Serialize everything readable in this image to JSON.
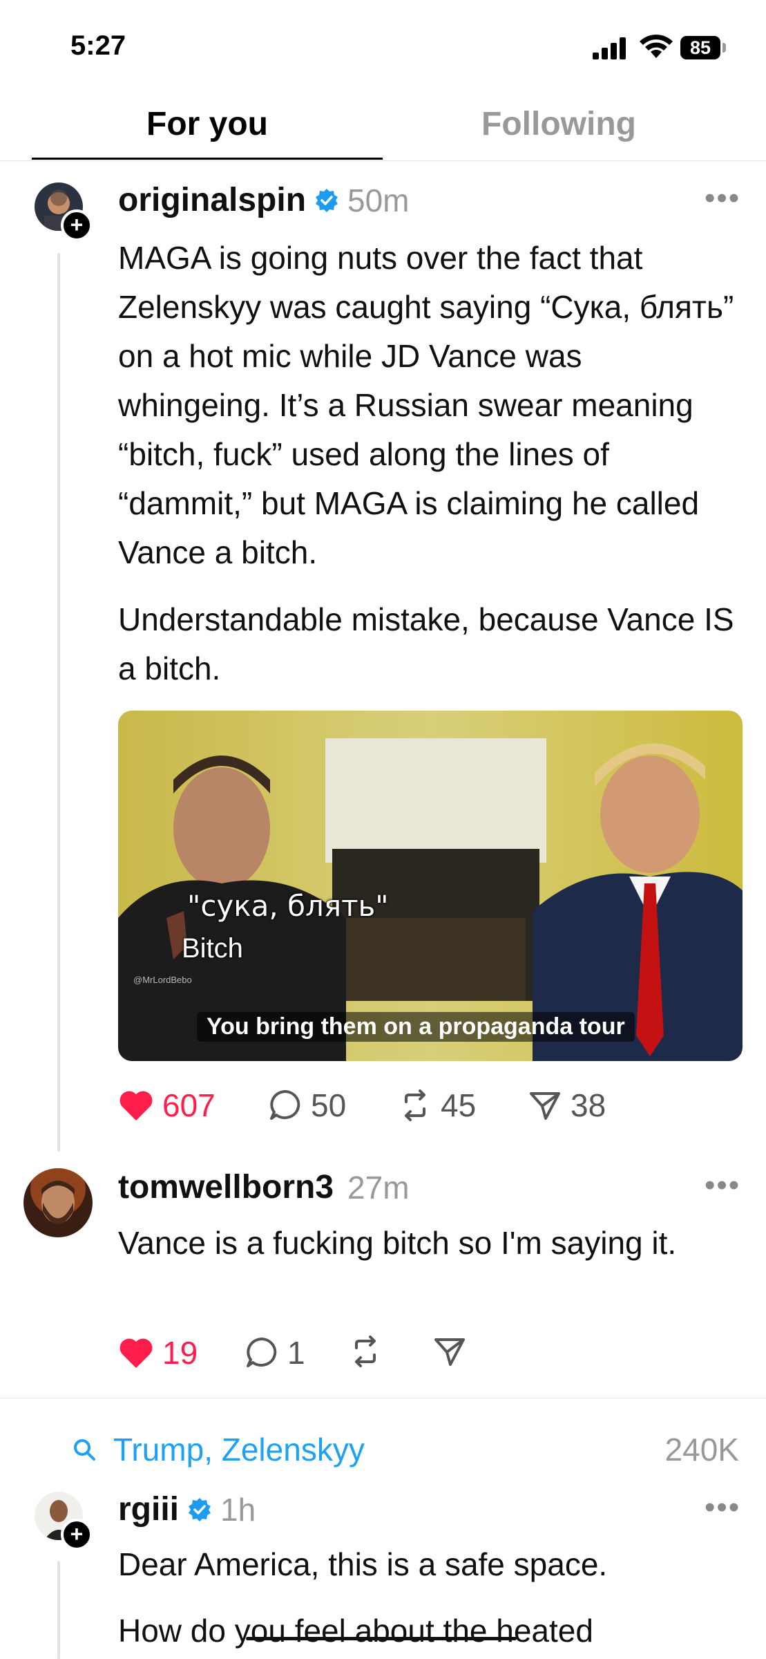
{
  "status_bar": {
    "time": "5:27",
    "battery": "85"
  },
  "tabs": [
    {
      "label": "For you"
    },
    {
      "label": "Following"
    }
  ],
  "posts": [
    {
      "username": "originalspin",
      "age": "50m",
      "paragraphs": [
        "MAGA is going nuts over the fact that Zelenskyy was caught saying “Сука, блять” on a hot mic while JD Vance was whingeing. It’s a Russian swear meaning “bitch, fuck” used along the lines of “dammit,” but MAGA is claiming he called Vance a bitch.",
        "Understandable mistake, because Vance IS a bitch."
      ],
      "media": {
        "caption_ru": "\"сука, блять\"",
        "caption_en": "Bitch",
        "watermark": "@MrLordBebo",
        "subtitle": "You bring them on a propaganda tour"
      },
      "likes": "607",
      "replies": "50",
      "reposts": "45",
      "shares": "38"
    },
    {
      "username": "tomwellborn3",
      "age": "27m",
      "text": "Vance is a fucking bitch so I'm saying it.",
      "likes": "19",
      "replies": "1"
    }
  ],
  "topic": {
    "label": "Trump, Zelenskyy",
    "count": "240K"
  },
  "next_post": {
    "username": "rgiii",
    "age": "1h",
    "paragraph1": "Dear America, this is a safe space.",
    "paragraph2": "How do you feel about the heated"
  },
  "colors": {
    "like": "#ff1e4b",
    "verified": "#1d9bf0",
    "topic": "#1da1f2"
  }
}
